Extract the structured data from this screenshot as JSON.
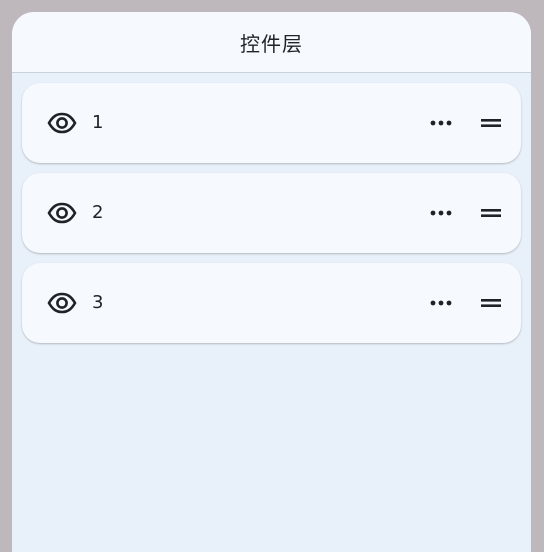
{
  "header": {
    "title": "控件层"
  },
  "layers": [
    {
      "label": "1",
      "visibility_icon": "eye-icon",
      "menu_icon": "more-horizontal-icon",
      "drag_icon": "drag-handle-icon"
    },
    {
      "label": "2",
      "visibility_icon": "eye-icon",
      "menu_icon": "more-horizontal-icon",
      "drag_icon": "drag-handle-icon"
    },
    {
      "label": "3",
      "visibility_icon": "eye-icon",
      "menu_icon": "more-horizontal-icon",
      "drag_icon": "drag-handle-icon"
    }
  ],
  "colors": {
    "backdrop": "#beb8bd",
    "panel_background": "#e8f0f9",
    "card_background": "#f6f9fe",
    "text": "#1f2328"
  }
}
